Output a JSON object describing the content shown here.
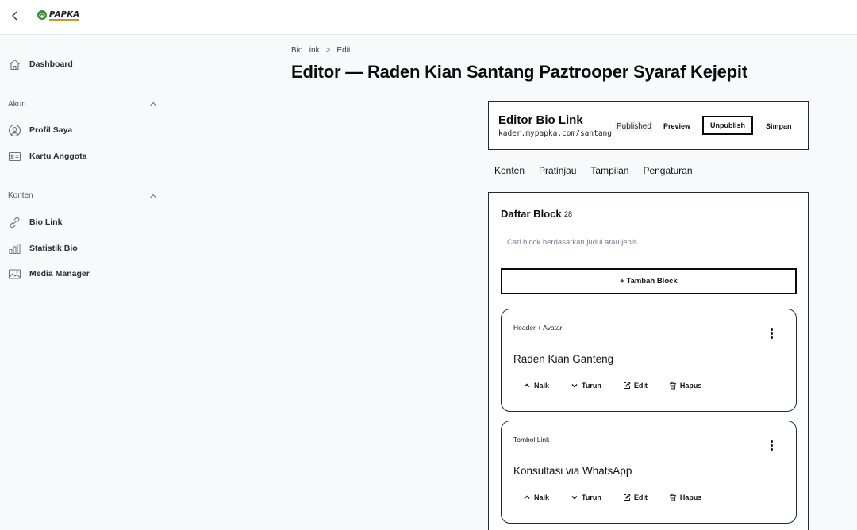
{
  "app": {
    "logo_text": "PAPKA"
  },
  "sidebar": {
    "dashboard": "Dashboard",
    "sections": [
      {
        "label": "Akun",
        "items": [
          "Profil Saya",
          "Kartu Anggota"
        ]
      },
      {
        "label": "Konten",
        "items": [
          "Bio Link",
          "Statistik Bio",
          "Media Manager"
        ]
      }
    ]
  },
  "breadcrumb": {
    "parent": "Bio Link",
    "separator": ">",
    "current": "Edit"
  },
  "page": {
    "title": "Editor — Raden Kian Santang Paztrooper Syaraf Kejepit"
  },
  "editor": {
    "title": "Editor Bio Link",
    "url": "kader.mypapka.com/santang",
    "status": "Published",
    "preview_label": "Preview",
    "unpublish_label": "Unpublish",
    "save_label": "Simpan"
  },
  "tabs": [
    "Konten",
    "Pratinjau",
    "Tampilan",
    "Pengaturan"
  ],
  "blocks": {
    "title": "Daftar Block",
    "count": "28",
    "search_placeholder": "Cari block berdasarkan judul atau jenis...",
    "add_label": "+ Tambah Block",
    "items": [
      {
        "type": "Header + Avatar",
        "title": "Raden Kian Ganteng"
      },
      {
        "type": "Tombol Link",
        "title": "Konsultasi via WhatsApp"
      }
    ],
    "actions": {
      "up": "Naik",
      "down": "Turun",
      "edit": "Edit",
      "delete": "Hapus"
    }
  }
}
